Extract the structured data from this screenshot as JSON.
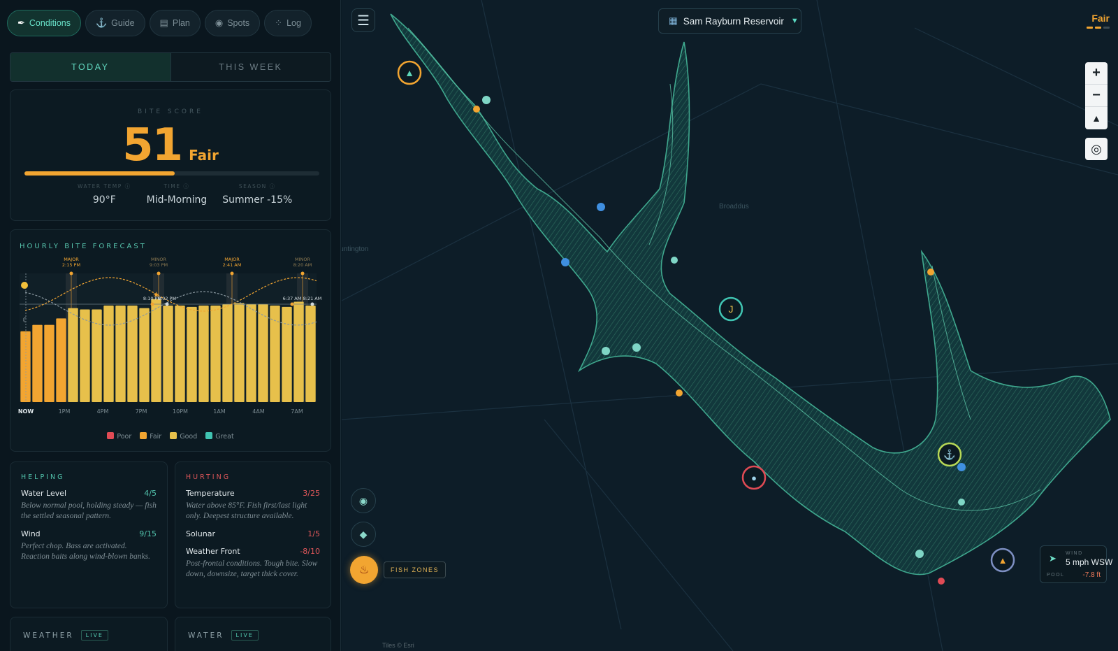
{
  "nav": {
    "items": [
      {
        "label": "Conditions",
        "icon": "fishing-rod-icon",
        "glyph": "✒",
        "active": true
      },
      {
        "label": "Guide",
        "icon": "angler-icon",
        "glyph": "⚓",
        "active": false
      },
      {
        "label": "Plan",
        "icon": "clipboard-icon",
        "glyph": "▤",
        "active": false
      },
      {
        "label": "Spots",
        "icon": "pin-icon",
        "glyph": "◉",
        "active": false
      },
      {
        "label": "Log",
        "icon": "bass-icon",
        "glyph": "⁘",
        "active": false
      }
    ]
  },
  "tabs": {
    "today": "TODAY",
    "week": "THIS WEEK"
  },
  "bite": {
    "label": "BITE SCORE",
    "score": "51",
    "rating": "Fair",
    "progress": 0.51,
    "stats": [
      {
        "label": "WATER TEMP ⓘ",
        "value": "90°F"
      },
      {
        "label": "TIME ⓘ",
        "value": "Mid-Morning"
      },
      {
        "label": "SEASON ⓘ",
        "value": "Summer -15%"
      }
    ]
  },
  "forecast": {
    "title": "HOURLY BITE FORECAST",
    "legend": [
      {
        "label": "Poor",
        "color": "#e04b55"
      },
      {
        "label": "Fair",
        "color": "#f2a531"
      },
      {
        "label": "Good",
        "color": "#e7c04b"
      },
      {
        "label": "Great",
        "color": "#40c4b2"
      }
    ]
  },
  "chart_data": {
    "type": "bar",
    "title": "HOURLY BITE FORECAST",
    "x_tick_labels": [
      "NOW",
      "1PM",
      "4PM",
      "7PM",
      "10PM",
      "1AM",
      "4AM",
      "7AM"
    ],
    "values": [
      55,
      60,
      60,
      65,
      73,
      72,
      72,
      75,
      75,
      75,
      73,
      80,
      75,
      75,
      74,
      75,
      75,
      76,
      77,
      76,
      76,
      75,
      74,
      78,
      75
    ],
    "colors": [
      "fair",
      "fair",
      "fair",
      "fair",
      "good",
      "good",
      "good",
      "good",
      "good",
      "good",
      "good",
      "good",
      "good",
      "good",
      "good",
      "good",
      "good",
      "good",
      "good",
      "good",
      "good",
      "good",
      "good",
      "good",
      "good"
    ],
    "star_index": 11,
    "periods": [
      {
        "type": "MAJOR",
        "time": "2:15 PM"
      },
      {
        "type": "MINOR",
        "time": "9:03 PM"
      },
      {
        "type": "MAJOR",
        "time": "2:41 AM"
      },
      {
        "type": "MINOR",
        "time": "8:20 AM"
      }
    ],
    "sun_moon_labels": [
      "8:10 PM",
      "9:02 PM",
      "6:37 AM",
      "8:21 AM"
    ],
    "legend": [
      "Poor",
      "Fair",
      "Good",
      "Great"
    ]
  },
  "helping": {
    "title": "HELPING",
    "items": [
      {
        "name": "Water Level",
        "score": "4/5",
        "desc": "Below normal pool, holding steady — fish the settled seasonal pattern."
      },
      {
        "name": "Wind",
        "score": "9/15",
        "desc": "Perfect chop. Bass are activated. Reaction baits along wind-blown banks."
      }
    ]
  },
  "hurting": {
    "title": "HURTING",
    "items": [
      {
        "name": "Temperature",
        "score": "3/25",
        "desc": "Water above 85°F. Fish first/last light only. Deepest structure available."
      },
      {
        "name": "Solunar",
        "score": "1/5",
        "desc": ""
      },
      {
        "name": "Weather Front",
        "score": "-8/10",
        "desc": "Post-frontal conditions. Tough bite. Slow down, downsize, target thick cover."
      }
    ]
  },
  "weather": {
    "title": "WEATHER",
    "live": "LIVE"
  },
  "water": {
    "title": "WATER",
    "live": "LIVE"
  },
  "map": {
    "reservoir": "Sam Rayburn Reservoir",
    "corner_rating": "Fair",
    "town_labels": [
      "Broaddus",
      "Huntington"
    ],
    "attribution": "Tiles © Esri",
    "fish_zones": "FISH ZONES",
    "wind_label": "WIND",
    "wind_value": "5 mph WSW",
    "pool_label": "POOL",
    "pool_value": "-7.8 ft",
    "colors": {
      "fair": "#f2a531",
      "good": "#e7c04b",
      "teal": "#40c4b2",
      "water": "#0f3a3e"
    }
  }
}
